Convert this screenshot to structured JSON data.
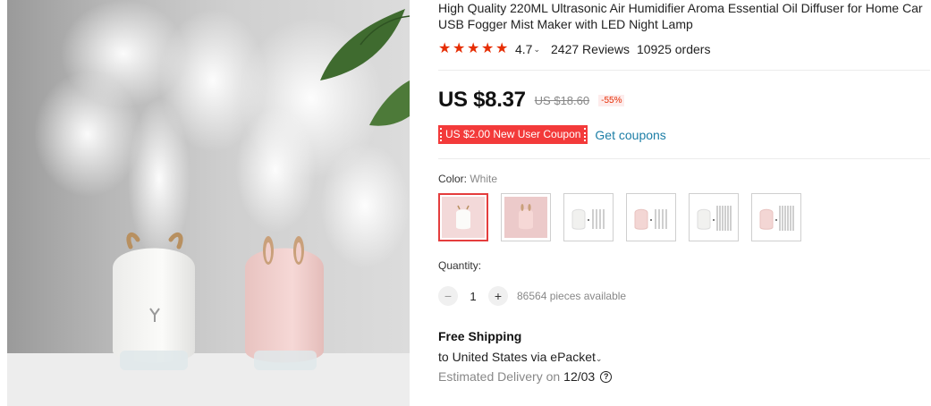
{
  "product": {
    "title": "High Quality 220ML Ultrasonic Air Humidifier Aroma Essential Oil Diffuser for Home Car USB Fogger Mist Maker with LED Night Lamp",
    "image_icon": "humidifier-photo"
  },
  "rating": {
    "stars": 5,
    "value": "4.7",
    "caret": "⌄",
    "reviews": "2427 Reviews",
    "orders": "10925 orders",
    "star_color": "#e62e04"
  },
  "price": {
    "current": "US $8.37",
    "original": "US $18.60",
    "discount": "-55%"
  },
  "coupon": {
    "label": "US $2.00 New User Coupon",
    "action": "Get coupons",
    "color": "#f33a3a"
  },
  "color_option": {
    "label": "Color:",
    "selected_value": "White",
    "swatches": [
      "white-deer",
      "pink-rabbit",
      "white-deer-kit",
      "pink-rabbit-kit",
      "white-deer-kit-large",
      "pink-rabbit-kit-large"
    ]
  },
  "quantity": {
    "label": "Quantity:",
    "minus": "−",
    "value": "1",
    "plus": "+",
    "available": "86564 pieces available"
  },
  "shipping": {
    "title": "Free Shipping",
    "to": "to United States via ePacket",
    "caret": "⌄",
    "estimated_label": "Estimated Delivery on",
    "date": "12/03",
    "help_icon": "?"
  }
}
